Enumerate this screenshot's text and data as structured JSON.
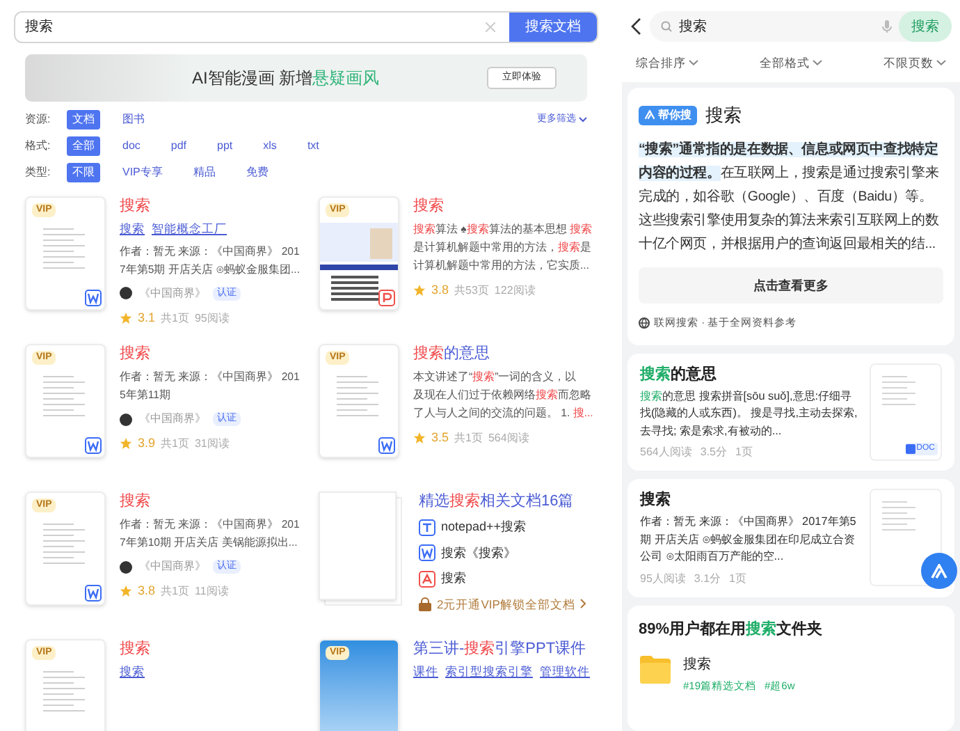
{
  "left": {
    "search": {
      "value": "搜索",
      "button": "搜索文档"
    },
    "banner": {
      "text": "AI智能漫画 新增",
      "highlight": "悬疑画风",
      "button": "立即体验"
    },
    "filters": [
      {
        "label": "资源:",
        "options": [
          {
            "label": "文档",
            "selected": true
          },
          {
            "label": "图书",
            "selected": false
          }
        ]
      },
      {
        "label": "格式:",
        "options": [
          {
            "label": "全部",
            "selected": true
          },
          {
            "label": "doc",
            "selected": false
          },
          {
            "label": "pdf",
            "selected": false
          },
          {
            "label": "ppt",
            "selected": false
          },
          {
            "label": "xls",
            "selected": false
          },
          {
            "label": "txt",
            "selected": false
          }
        ]
      },
      {
        "label": "类型:",
        "options": [
          {
            "label": "不限",
            "selected": true
          },
          {
            "label": "VIP专享",
            "selected": false
          },
          {
            "label": "精品",
            "selected": false
          },
          {
            "label": "免费",
            "selected": false
          }
        ]
      }
    ],
    "more_filters": "更多筛选",
    "results": [
      {
        "kind": "page",
        "badge": "VIP",
        "file_icon": {
          "kind": "word"
        },
        "title": [
          {
            "text": "搜索",
            "hl": true
          }
        ],
        "tags": [
          "搜索",
          "智能概念工厂"
        ],
        "desc": [
          [
            {
              "text": "作者：暂无 来源：《中国商界》 201",
              "hl": false
            }
          ],
          [
            {
              "text": "7年第5期 开店关店 ⊙蚂蚁金服集团...",
              "hl": false
            }
          ]
        ],
        "source": "《中国商界》",
        "source_badge": "认证",
        "rating": "3.1",
        "pages": "共1页",
        "reads": "95阅读"
      },
      {
        "kind": "slide",
        "badge": "VIP",
        "file_icon": {
          "kind": "ppt"
        },
        "title": [
          {
            "text": "搜索",
            "hl": true
          }
        ],
        "desc": [
          [
            {
              "text": "搜索",
              "hl": true
            },
            {
              "text": "算法 ♠",
              "hl": false
            },
            {
              "text": "搜索",
              "hl": true
            },
            {
              "text": "算法的基本思想 ",
              "hl": false
            },
            {
              "text": "搜索",
              "hl": true
            }
          ],
          [
            {
              "text": "是计算机解题中常用的方法，",
              "hl": false
            },
            {
              "text": "搜索",
              "hl": true
            },
            {
              "text": "是",
              "hl": false
            }
          ],
          [
            {
              "text": "计算机解题中常用的方法，它实质...",
              "hl": false
            }
          ]
        ],
        "rating": "3.8",
        "pages": "共53页",
        "reads": "122阅读"
      },
      {
        "kind": "page",
        "badge": "VIP",
        "file_icon": {
          "kind": "word"
        },
        "title": [
          {
            "text": "搜索",
            "hl": true
          }
        ],
        "desc": [
          [
            {
              "text": "作者：暂无 来源：《中国商界》 201",
              "hl": false
            }
          ],
          [
            {
              "text": "5年第11期",
              "hl": false
            }
          ]
        ],
        "source": "《中国商界》",
        "source_badge": "认证",
        "rating": "3.9",
        "pages": "共1页",
        "reads": "31阅读"
      },
      {
        "kind": "page",
        "badge": "VIP",
        "file_icon": {
          "kind": "word"
        },
        "title": [
          {
            "text": "搜索",
            "hl": true
          },
          {
            "text": "的意思",
            "hl": false
          }
        ],
        "desc": [
          [
            {
              "text": "本文讲述了“",
              "hl": false
            },
            {
              "text": "搜索",
              "hl": true
            },
            {
              "text": "”一词的含义，以",
              "hl": false
            }
          ],
          [
            {
              "text": "及现在人们过于依赖网络",
              "hl": false
            },
            {
              "text": "搜索",
              "hl": true
            },
            {
              "text": "而忽略",
              "hl": false
            }
          ],
          [
            {
              "text": "了人与人之间的交流的问题。 1. ",
              "hl": false
            },
            {
              "text": "搜...",
              "hl": true
            }
          ]
        ],
        "rating": "3.5",
        "pages": "共1页",
        "reads": "564阅读"
      },
      {
        "kind": "page",
        "badge": "VIP",
        "file_icon": {
          "kind": "word"
        },
        "title": [
          {
            "text": "搜索",
            "hl": true
          }
        ],
        "desc": [
          [
            {
              "text": "作者：暂无 来源：《中国商界》 201",
              "hl": false
            }
          ],
          [
            {
              "text": "7年第10期 开店关店 美锅能源拟出...",
              "hl": false
            }
          ]
        ],
        "source": "《中国商界》",
        "source_badge": "认证",
        "rating": "3.8",
        "pages": "共1页",
        "reads": "11阅读"
      },
      {
        "kind": "bundle",
        "title": [
          {
            "text": "精选",
            "hl": false
          },
          {
            "text": "搜索",
            "hl": true
          },
          {
            "text": "相关文档16篇",
            "hl": false
          }
        ],
        "files": [
          {
            "kind": "txt",
            "name": "notepad++搜索"
          },
          {
            "kind": "word",
            "name": "搜索《搜索》"
          },
          {
            "kind": "pdf",
            "name": "搜索"
          }
        ],
        "promo": "2元开通VIP解锁全部文档"
      },
      {
        "kind": "page",
        "badge": "VIP",
        "title": [
          {
            "text": "搜索",
            "hl": true
          }
        ],
        "tags": [
          "搜索"
        ]
      },
      {
        "kind": "cover",
        "badge": "VIP",
        "title": [
          {
            "text": "第三讲-",
            "hl": false
          },
          {
            "text": "搜索",
            "hl": true
          },
          {
            "text": "引擎PPT课件",
            "hl": false
          }
        ],
        "tags": [
          "课件",
          "索引型搜索引擎",
          "管理软件"
        ]
      }
    ]
  },
  "right": {
    "search": {
      "value": "搜索",
      "button": "搜索"
    },
    "sorts": [
      "综合排序",
      "全部格式",
      "不限页数"
    ],
    "ai_card": {
      "badge": "帮你搜",
      "title": "搜索",
      "highlight": "“搜索”通常指的是在数据、信息或网页中查找特定内容的过程。",
      "text": "在互联网上，搜索是通过搜索引擎来完成的，如谷歌（Google）、百度（Baidu）等。这些搜索引擎使用复杂的算法来索引互联网上的数十亿个网页，并根据用户的查询返回最相关的结...",
      "button": "点击查看更多",
      "footer": "联网搜索 · 基于全网资料参考"
    },
    "results": [
      {
        "title": [
          {
            "text": "搜索",
            "hl": true
          },
          {
            "text": "的意思",
            "hl": false
          }
        ],
        "desc": [
          {
            "text": "搜索",
            "hl": true
          },
          {
            "text": "的意思 搜索拼音[sōu suǒ],意思:仔细寻找(隐藏的人或东西)。 搜是寻找,主动去探索,去寻找; 索是索求,有被动的...",
            "hl": false
          }
        ],
        "meta": [
          "564人阅读",
          "3.5分",
          "1页"
        ],
        "file_label": "DOC"
      },
      {
        "title": [
          {
            "text": "搜索",
            "hl": false
          }
        ],
        "desc": [
          {
            "text": "作者：暂无 来源：《中国商界》 2017年第5期 开店关店 ⊙蚂蚁金服集团在印尼成立合资公司 ⊙太阳雨百万产能的空...",
            "hl": false
          }
        ],
        "meta": [
          "95人阅读",
          "3.1分",
          "1页"
        ]
      }
    ],
    "folder": {
      "title": [
        {
          "text": "89%用户都在用",
          "hl": false
        },
        {
          "text": "搜索",
          "hl": true
        },
        {
          "text": "文件夹",
          "hl": false
        }
      ],
      "name": "搜索",
      "tags": [
        "#19篇精选文档",
        "#超6w"
      ]
    }
  }
}
